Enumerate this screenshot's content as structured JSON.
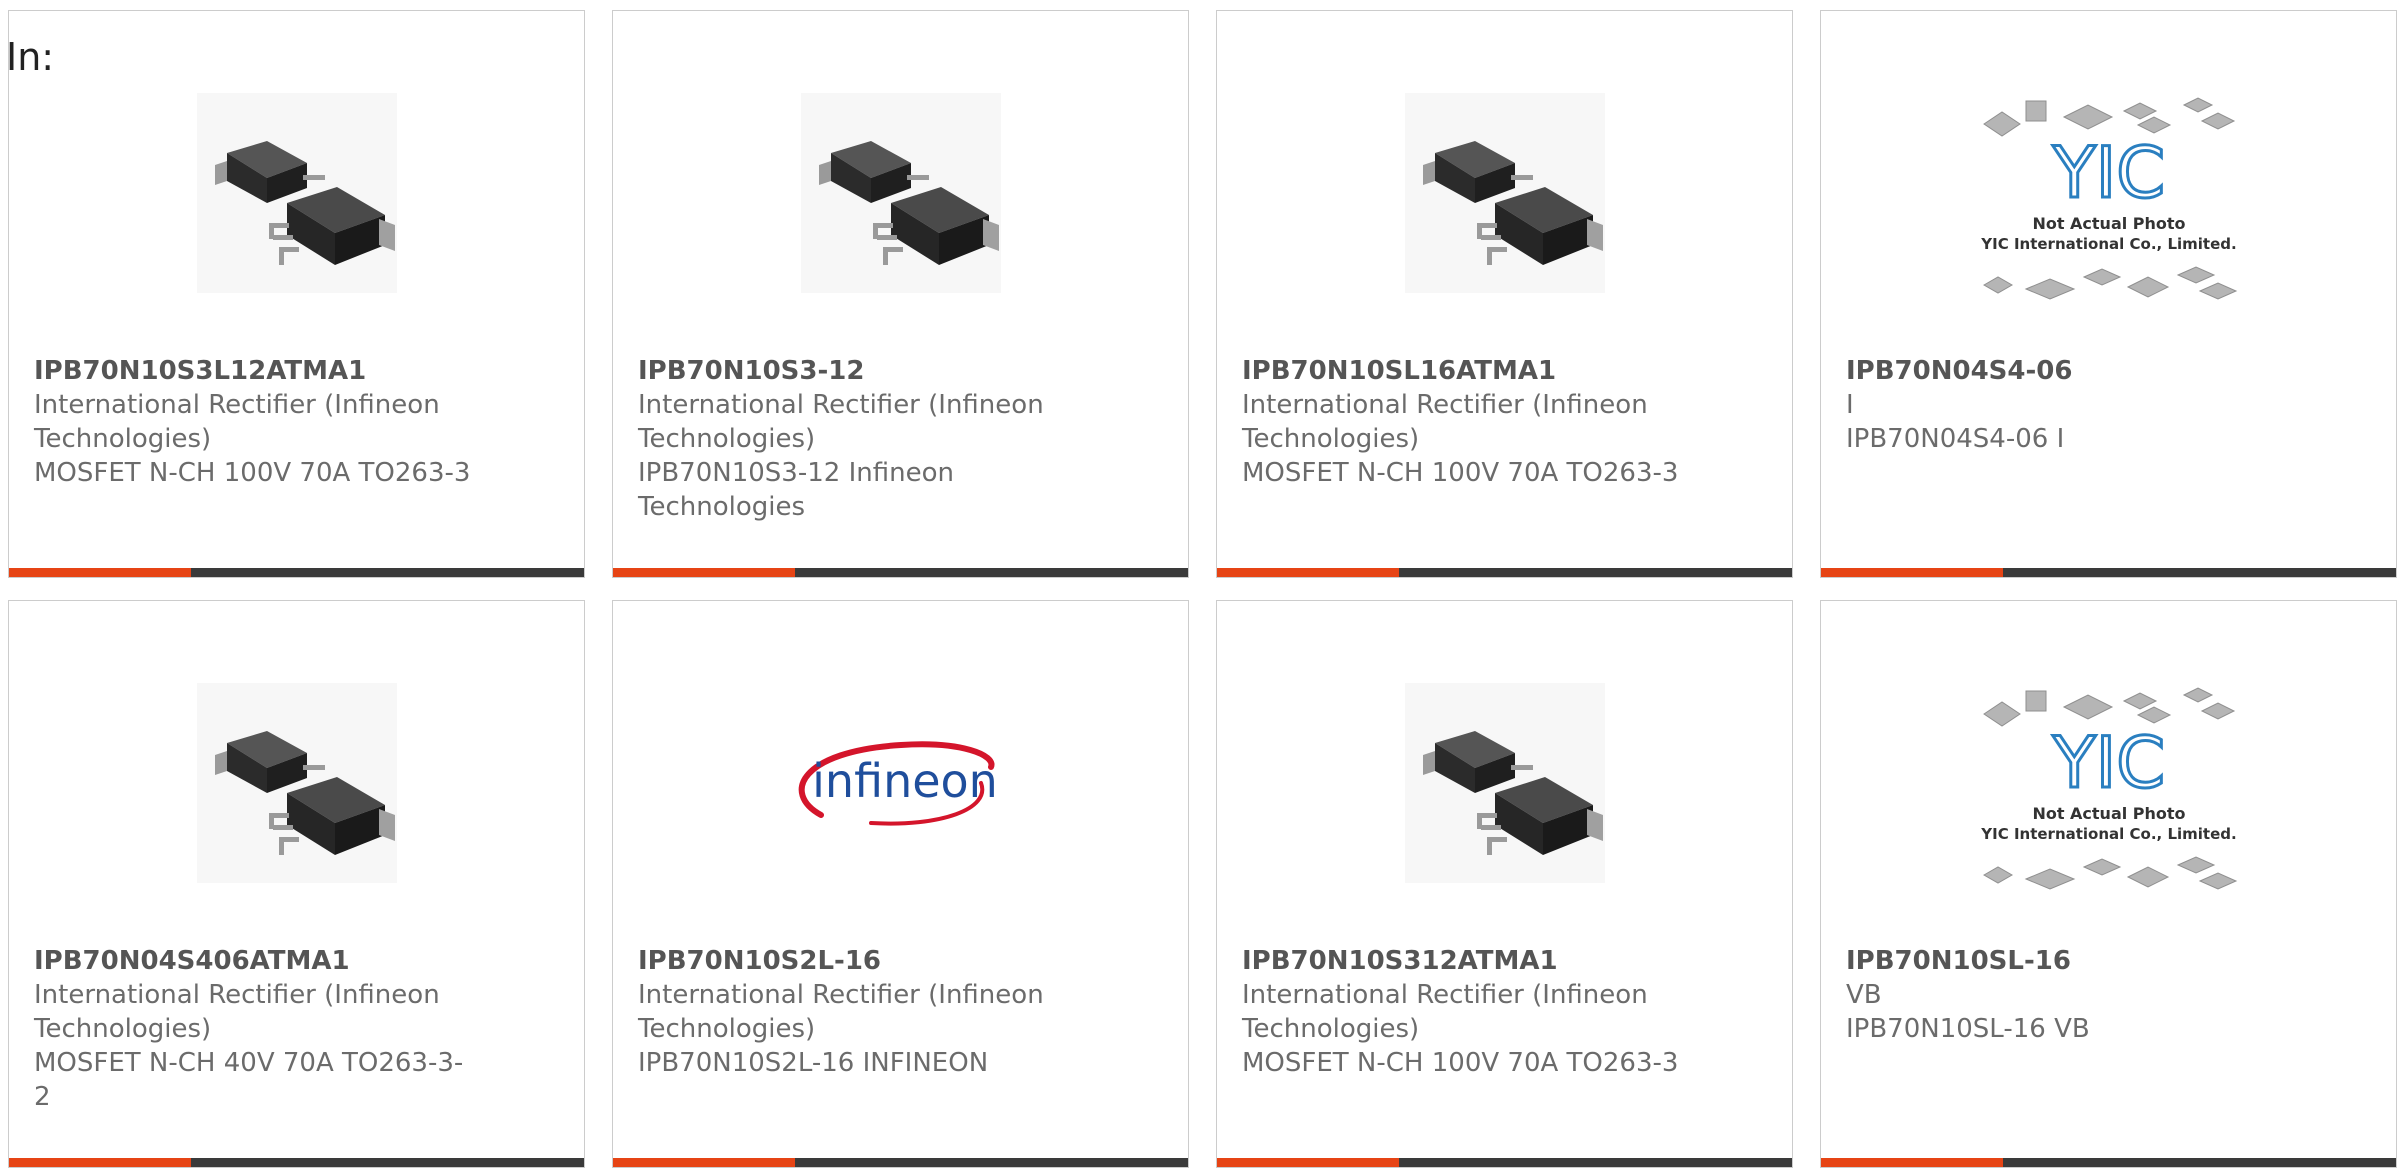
{
  "header": {
    "label": "In:"
  },
  "colors": {
    "accent": "#e64415",
    "bar": "#3a3a3a",
    "border": "#cccccc",
    "text": "#6b6b6b",
    "infineon_blue": "#1f4e9c",
    "infineon_red": "#d4152b",
    "yic_blue": "#2a7fc0"
  },
  "products": [
    {
      "part": "IPB70N10S3L12ATMA1",
      "maker": "International Rectifier (Infineon Technologies)",
      "desc": "MOSFET N-CH 100V 70A TO263-3",
      "image": "to263-package-photo"
    },
    {
      "part": "IPB70N10S3-12",
      "maker": "International Rectifier (Infineon Technologies)",
      "desc": "IPB70N10S3-12 Infineon Technologies",
      "image": "to263-package-photo"
    },
    {
      "part": "IPB70N10SL16ATMA1",
      "maker": "International Rectifier (Infineon Technologies)",
      "desc": "MOSFET N-CH 100V 70A TO263-3",
      "image": "to263-package-photo"
    },
    {
      "part": "IPB70N04S4-06",
      "maker": "I",
      "desc": "IPB70N04S4-06 I",
      "image": "yic-placeholder",
      "placeholder_line1": "Not Actual Photo",
      "placeholder_line2": "YIC International Co., Limited.",
      "placeholder_logo": "YIC"
    },
    {
      "part": "IPB70N04S406ATMA1",
      "maker": "International Rectifier (Infineon Technologies)",
      "desc": "MOSFET N-CH 40V 70A TO263-3-2",
      "image": "to263-package-photo"
    },
    {
      "part": "IPB70N10S2L-16",
      "maker": "International Rectifier (Infineon Technologies)",
      "desc": "IPB70N10S2L-16 INFINEON",
      "image": "infineon-logo",
      "logo_text": "infineon"
    },
    {
      "part": "IPB70N10S312ATMA1",
      "maker": "International Rectifier (Infineon Technologies)",
      "desc": "MOSFET N-CH 100V 70A TO263-3",
      "image": "to263-package-photo"
    },
    {
      "part": "IPB70N10SL-16",
      "maker": "VB",
      "desc": "IPB70N10SL-16 VB",
      "image": "yic-placeholder",
      "placeholder_line1": "Not Actual Photo",
      "placeholder_line2": "YIC International Co., Limited.",
      "placeholder_logo": "YIC"
    }
  ]
}
